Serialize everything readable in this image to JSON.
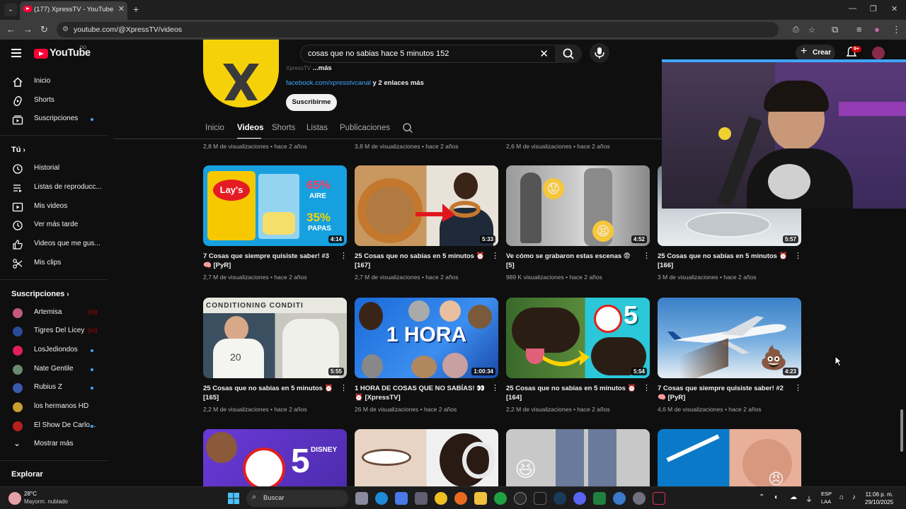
{
  "browser": {
    "tab_title": "(177) XpressTV - YouTube",
    "url": "youtube.com/@XpressTV/videos"
  },
  "header": {
    "logo_text": "YouTube",
    "country_code": "DO",
    "search_value": "cosas que no sabias hace 5 minutos 152",
    "create_label": "Crear",
    "notif_count": "9+"
  },
  "sidebar": {
    "main": [
      {
        "label": "Inicio",
        "icon": "home-icon"
      },
      {
        "label": "Shorts",
        "icon": "shorts-icon"
      },
      {
        "label": "Suscripciones",
        "icon": "subscriptions-icon"
      }
    ],
    "you_heading": "Tú",
    "you": [
      {
        "label": "Historial",
        "icon": "history-icon"
      },
      {
        "label": "Listas de reproducc...",
        "icon": "playlist-icon"
      },
      {
        "label": "Mis videos",
        "icon": "my-videos-icon"
      },
      {
        "label": "Ver más tarde",
        "icon": "watch-later-icon"
      },
      {
        "label": "Videos que me gus...",
        "icon": "like-icon"
      },
      {
        "label": "Mis clips",
        "icon": "clips-icon"
      }
    ],
    "subs_heading": "Suscripciones",
    "subs": [
      {
        "label": "Artemisa",
        "live": true,
        "color": "#c45a7a"
      },
      {
        "label": "Tigres Del Licey",
        "live": true,
        "color": "#2a4a9a"
      },
      {
        "label": "LosJediondos",
        "live": false,
        "color": "#e0205a"
      },
      {
        "label": "Nate Gentile",
        "live": false,
        "color": "#6a8a70"
      },
      {
        "label": "Rubius Z",
        "live": false,
        "color": "#3a5aaa"
      },
      {
        "label": "los hermanos HD",
        "live": false,
        "color": "#c8a030"
      },
      {
        "label": "El Show De Carlo...",
        "live": false,
        "color": "#b82020"
      }
    ],
    "show_more": "Mostrar más",
    "explore_heading": "Explorar"
  },
  "channel": {
    "handle_text": "XpressTV",
    "more_text": "...más",
    "link": "facebook.com/xpresstvcanal",
    "link_more": "y 2 enlaces más",
    "subscribe_label": "Suscribirme",
    "tabs": [
      "Inicio",
      "Videos",
      "Shorts",
      "Listas",
      "Publicaciones"
    ]
  },
  "prev_row_stats": [
    "2,8 M de visualizaciones • hace 2 años",
    "3,8 M de visualizaciones • hace 2 años",
    "2,6 M de visualizaciones • hace 2 años"
  ],
  "videos_row1": [
    {
      "title": "7 Cosas que siempre quisiste saber! #3 🧠 [PyR]",
      "stats": "2,7 M de visualizaciones • hace 2 años",
      "duration": "4:14",
      "thumb_text_a": "65%",
      "thumb_text_b": "AIRE",
      "thumb_text_c": "35%",
      "thumb_text_d": "PAPAS",
      "brand": "Lay's"
    },
    {
      "title": "25 Cosas que no sabías en 5 minutos ⏰ [167]",
      "stats": "2,7 M de visualizaciones • hace 2 años",
      "duration": "5:33"
    },
    {
      "title": "Ve cómo se grabaron estas escenas 😨 [5]",
      "stats": "989 K visualizaciones • hace 2 años",
      "duration": "4:52"
    },
    {
      "title": "25 Cosas que no sabías en 5 minutos ⏰ [166]",
      "stats": "3 M de visualizaciones • hace 2 años",
      "duration": "5:57"
    }
  ],
  "videos_row2": [
    {
      "title": "25 Cosas que no sabías en 5 minutos ⏰ [165]",
      "stats": "2,2 M de visualizaciones • hace 2 años",
      "duration": "5:55",
      "thumb_text": "20"
    },
    {
      "title": "1 HORA DE COSAS QUE NO SABÍAS! 👀 ⏰ [XpressTV]",
      "stats": "26 M de visualizaciones • hace 2 años",
      "duration": "1:00:34",
      "thumb_text": "1 HORA"
    },
    {
      "title": "25 Cosas que no sabías en 5 minutos ⏰ [164]",
      "stats": "2,2 M de visualizaciones • hace 2 años",
      "duration": "5:54",
      "thumb_text": "5"
    },
    {
      "title": "7 Cosas que siempre quisiste saber! #2 🧠 [PyR]",
      "stats": "4,6 M de visualizaciones • hace 2 años",
      "duration": "4:23"
    }
  ],
  "row3_thumb_text": {
    "digit": "5",
    "brand": "DISNEY"
  },
  "taskbar": {
    "temp": "28°C",
    "weather": "Mayorm. nublado",
    "search_label": "Buscar",
    "lang": "ESP",
    "lang_sub": "LAA",
    "time": "11:06 p. m.",
    "date": "29/10/2025"
  },
  "colors": {
    "bg": "#0f0f0f",
    "brand_red": "#ff0033",
    "link_blue": "#3ea6ff",
    "channel_yellow": "#f5d10a"
  }
}
